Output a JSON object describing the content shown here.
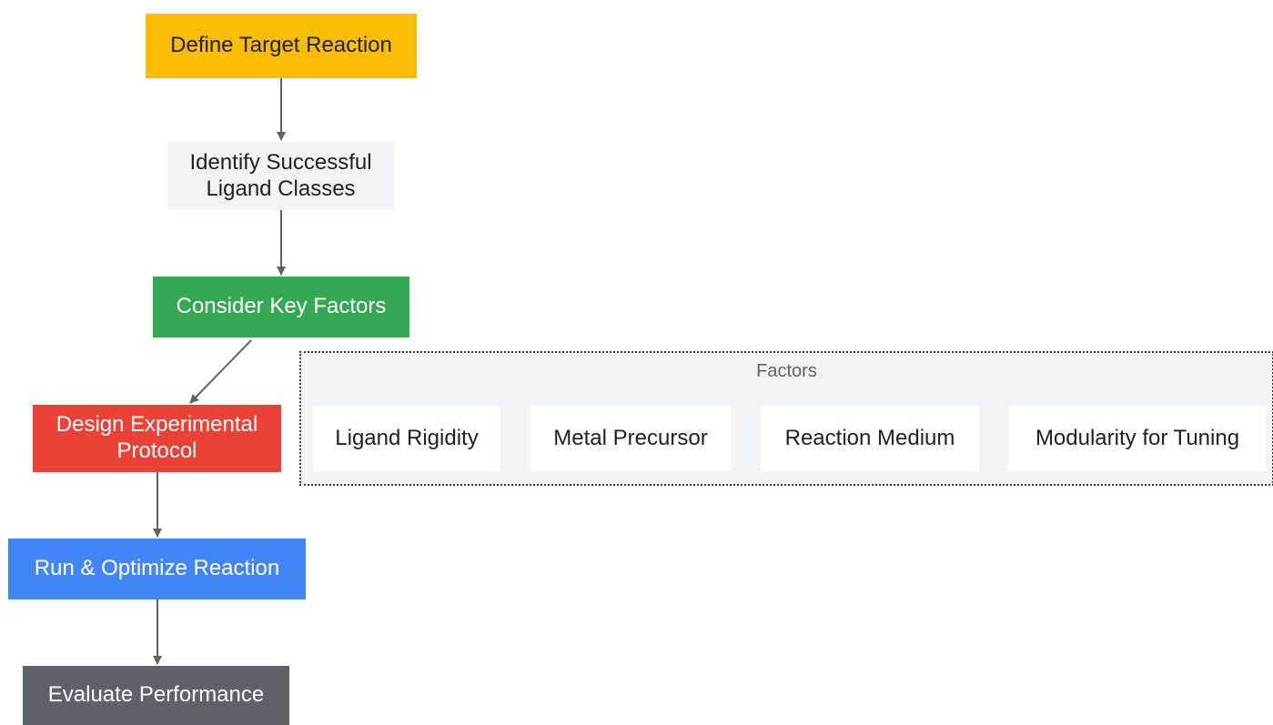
{
  "nodes": {
    "define": "Define Target Reaction",
    "identify": "Identify Successful\nLigand Classes",
    "consider": "Consider Key Factors",
    "design": "Design Experimental\nProtocol",
    "run": "Run & Optimize Reaction",
    "evaluate": "Evaluate Performance"
  },
  "factors": {
    "title": "Factors",
    "items": [
      "Ligand Rigidity",
      "Metal Precursor",
      "Reaction Medium",
      "Modularity for Tuning"
    ]
  },
  "colors": {
    "define": "#fbbc04",
    "identify": "#f1f3f4",
    "consider": "#34a853",
    "design": "#ea4335",
    "run": "#4285f4",
    "evaluate": "#5f6368",
    "edge": "#5f6368"
  }
}
